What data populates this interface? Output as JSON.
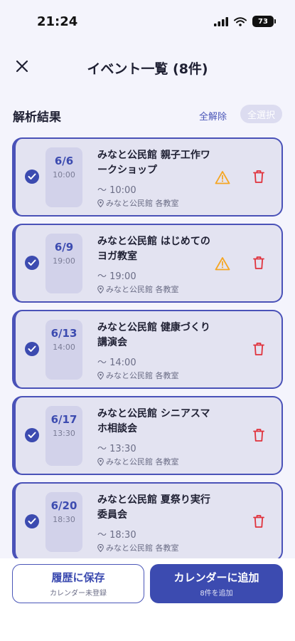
{
  "status_bar": {
    "time": "21:24",
    "battery": "73"
  },
  "header": {
    "title": "イベント一覧 (8件)"
  },
  "section": {
    "title": "解析結果",
    "deselect_label": "全解除",
    "select_label": "全選択"
  },
  "events": [
    {
      "date": "6/6",
      "time": "10:00",
      "title": "みなと公民館 親子工作ワークショップ",
      "time_range": "〜 10:00",
      "location": "みなと公民館 各教室",
      "warning": true
    },
    {
      "date": "6/9",
      "time": "19:00",
      "title": "みなと公民館 はじめてのヨガ教室",
      "time_range": "〜 19:00",
      "location": "みなと公民館 各教室",
      "warning": true
    },
    {
      "date": "6/13",
      "time": "14:00",
      "title": "みなと公民館 健康づくり講演会",
      "time_range": "〜 14:00",
      "location": "みなと公民館 各教室",
      "warning": false
    },
    {
      "date": "6/17",
      "time": "13:30",
      "title": "みなと公民館 シニアスマホ相談会",
      "time_range": "〜 13:30",
      "location": "みなと公民館 各教室",
      "warning": false
    },
    {
      "date": "6/20",
      "time": "18:30",
      "title": "みなと公民館 夏祭り実行委員会",
      "time_range": "〜 18:30",
      "location": "みなと公民館 各教室",
      "warning": false
    }
  ],
  "footer": {
    "history_label": "履歴に保存",
    "history_sub": "カレンダー未登録",
    "add_label": "カレンダーに追加",
    "add_sub": "8件を追加"
  },
  "colors": {
    "accent": "#3c4bb0",
    "warning": "#f5a623",
    "danger": "#e0323c",
    "card_bg": "#e3e3f1"
  },
  "icons": {
    "close": "close-icon",
    "check": "check-circle-icon",
    "warning": "warning-triangle-icon",
    "trash": "trash-icon",
    "location": "location-pin-icon"
  }
}
